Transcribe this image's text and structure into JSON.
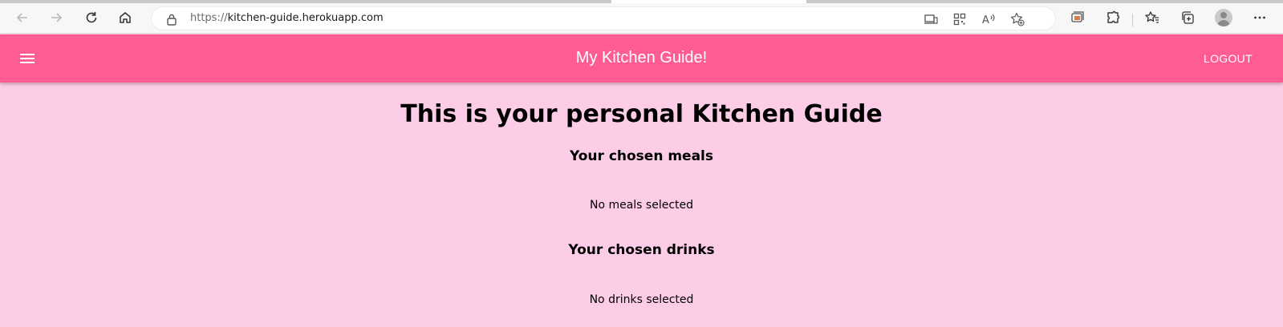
{
  "browser": {
    "url_scheme": "https://",
    "url_host": "kitchen-guide.herokuapp.com",
    "icons": [
      "back-icon",
      "forward-icon",
      "refresh-icon",
      "home-icon",
      "lock-icon",
      "app-available-icon",
      "qr-code-icon",
      "read-aloud-icon",
      "add-favorite-icon",
      "collections-icon",
      "extensions-icon",
      "favorites-icon",
      "tab-actions-icon",
      "profile-icon",
      "more-icon"
    ],
    "read_aloud_glyph": "A"
  },
  "appbar": {
    "title": "My Kitchen Guide!",
    "logout_label": "LOGOUT",
    "color": "#ff5c93"
  },
  "main": {
    "heading": "This is your personal Kitchen Guide",
    "meals": {
      "title": "Your chosen meals",
      "empty": "No meals selected"
    },
    "drinks": {
      "title": "Your chosen drinks",
      "empty": "No drinks selected"
    },
    "background": "#fdcde8"
  }
}
